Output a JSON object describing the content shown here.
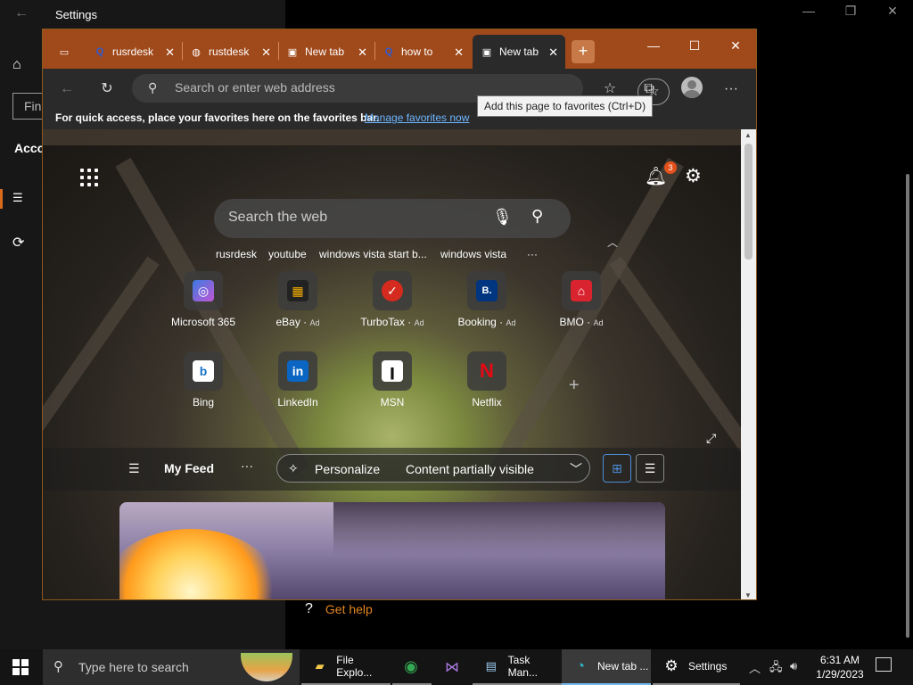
{
  "settings": {
    "title": "Settings",
    "back": "←",
    "find_placeholder": "Fin",
    "section_label": "Acco",
    "get_help": "Get help",
    "win_controls": [
      "—",
      "❐",
      "✕"
    ]
  },
  "edge": {
    "tabs": [
      {
        "label": "",
        "icon": "tab-actions-icon"
      },
      {
        "label": "rusrdesk",
        "icon": "search-icon"
      },
      {
        "label": "rustdesk",
        "icon": "github-icon"
      },
      {
        "label": "New tab",
        "icon": "newtab-icon"
      },
      {
        "label": "how to",
        "icon": "search-icon"
      },
      {
        "label": "New tab",
        "icon": "newtab-icon"
      }
    ],
    "new_tab": "+",
    "controls": [
      "—",
      "☐",
      "✕"
    ],
    "address_placeholder": "Search or enter web address",
    "favbar_msg": "For quick access, place your favorites here on the favorites bar.",
    "favbar_link": "Manage favorites now",
    "tooltip": "Add this page to favorites (Ctrl+D)"
  },
  "newtab": {
    "notification_count": "3",
    "search_placeholder": "Search the web",
    "quick_links": [
      "rusrdesk",
      "youtube",
      "windows vista start b...",
      "windows vista",
      "···"
    ],
    "tiles": [
      {
        "label": "Microsoft 365",
        "ad": "",
        "color": "#5a6bd8",
        "glyph": "◎"
      },
      {
        "label": "eBay",
        "ad": "Ad",
        "color": "#e5322d",
        "glyph": "▦"
      },
      {
        "label": "TurboTax",
        "ad": "Ad",
        "color": "#d52b1e",
        "glyph": "✓"
      },
      {
        "label": "Booking",
        "ad": "Ad",
        "color": "#003580",
        "glyph": "B."
      },
      {
        "label": "BMO",
        "ad": "Ad",
        "color": "#d9232e",
        "glyph": "⌂"
      },
      {
        "label": "Bing",
        "ad": "",
        "color": "#ffffff",
        "glyph": "b"
      },
      {
        "label": "LinkedIn",
        "ad": "",
        "color": "#0a66c2",
        "glyph": "in"
      },
      {
        "label": "MSN",
        "ad": "",
        "color": "#ffffff",
        "glyph": "ꞁ"
      },
      {
        "label": "Netflix",
        "ad": "",
        "color": "#e50914",
        "glyph": "N"
      }
    ],
    "feed": {
      "menu": "☰",
      "title": "My Feed",
      "more": "···",
      "personalize": "Personalize",
      "content_status": "Content partially visible"
    }
  },
  "taskbar": {
    "search_placeholder": "Type here to search",
    "apps": [
      {
        "label": "File Explo...",
        "icon": "folder-icon"
      },
      {
        "label": "",
        "icon": "chrome-icon"
      },
      {
        "label": "",
        "icon": "visual-studio-icon"
      },
      {
        "label": "Task Man...",
        "icon": "task-manager-icon"
      },
      {
        "label": "New tab ...",
        "icon": "edge-icon"
      },
      {
        "label": "Settings",
        "icon": "gear-icon"
      }
    ],
    "time": "6:31 AM",
    "date": "1/29/2023"
  }
}
